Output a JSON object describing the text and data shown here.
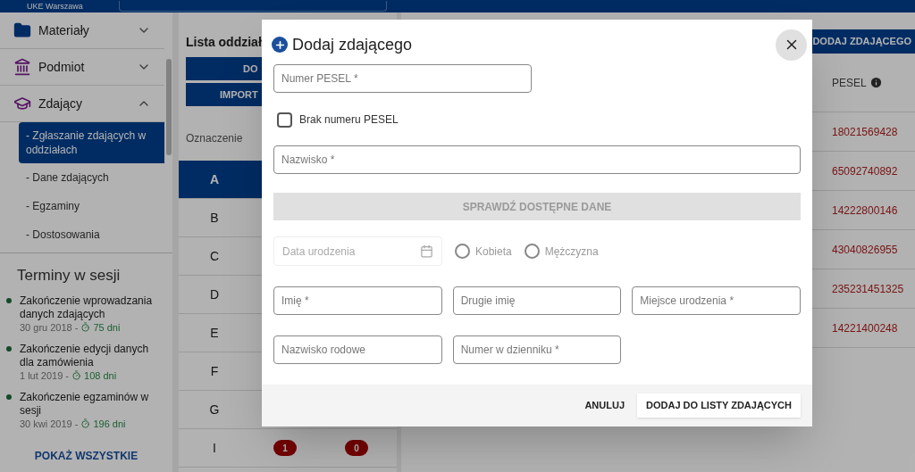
{
  "top_bar": {
    "organization": "UKE Warszawa"
  },
  "sidebar": {
    "items": [
      {
        "label": "Materiały",
        "kind": "folder",
        "expanded": false
      },
      {
        "label": "Podmiot",
        "kind": "institution",
        "expanded": false
      },
      {
        "label": "Zdający",
        "kind": "education",
        "expanded": true,
        "children": [
          {
            "label": "- Zgłaszanie zdających w oddziałach",
            "selected": true
          },
          {
            "label": "- Dane zdających",
            "selected": false
          },
          {
            "label": "- Egzaminy",
            "selected": false
          },
          {
            "label": "- Dostosowania",
            "selected": false
          }
        ]
      }
    ]
  },
  "deadlines": {
    "title": "Terminy w sesji",
    "items": [
      {
        "name": "Zakończenie wprowadzania danych zdających",
        "date": "30 gru 2018 -",
        "remaining": "75 dni"
      },
      {
        "name": "Zakończenie edycji danych dla zamówienia",
        "date": "1 lut 2019 -",
        "remaining": "108 dni"
      },
      {
        "name": "Zakończenie egzaminów w sesji",
        "date": "30 kwi 2019 -",
        "remaining": "196 dni"
      }
    ],
    "show_all": "POKAŻ WSZYSTKIE"
  },
  "branches": {
    "title": "Lista oddział",
    "buttons": [
      "DO",
      "IMPORT"
    ],
    "column": "Oznaczenie",
    "rows": [
      {
        "label": "A",
        "selected": true
      },
      {
        "label": "B",
        "selected": false
      },
      {
        "label": "C",
        "selected": false
      },
      {
        "label": "D",
        "selected": false
      },
      {
        "label": "E",
        "selected": false
      },
      {
        "label": "F",
        "selected": false
      },
      {
        "label": "G",
        "selected": false
      },
      {
        "label": "I",
        "selected": false,
        "badges": [
          "1",
          "0"
        ]
      }
    ]
  },
  "students": {
    "add_button": "DODAJ ZDAJĄCEGO",
    "column": "PESEL",
    "rows": [
      "18021569428",
      "65092740892",
      "14222800146",
      "43040826955",
      "235231451325",
      "14221400248"
    ]
  },
  "dialog": {
    "title": "Dodaj zdającego",
    "pesel": {
      "placeholder": "Numer PESEL *"
    },
    "no_pesel": {
      "label": "Brak numeru PESEL",
      "checked": false
    },
    "surname": {
      "placeholder": "Nazwisko *"
    },
    "check_button": {
      "label": "SPRAWDŹ DOSTĘPNE DANE",
      "disabled": true
    },
    "birth_date": {
      "placeholder": "Data urodzenia",
      "disabled": true
    },
    "sex": {
      "disabled": true,
      "options": [
        {
          "label": "Kobieta",
          "selected": false
        },
        {
          "label": "Mężczyzna",
          "selected": false
        }
      ]
    },
    "fields": [
      {
        "placeholder": "Imię *"
      },
      {
        "placeholder": "Drugie imię"
      },
      {
        "placeholder": "Miejsce urodzenia *"
      },
      {
        "placeholder": "Nazwisko rodowe"
      },
      {
        "placeholder": "Numer w dzienniku *"
      }
    ],
    "cancel": "ANULUJ",
    "submit": "DODAJ DO LISTY ZDAJĄCYCH"
  }
}
